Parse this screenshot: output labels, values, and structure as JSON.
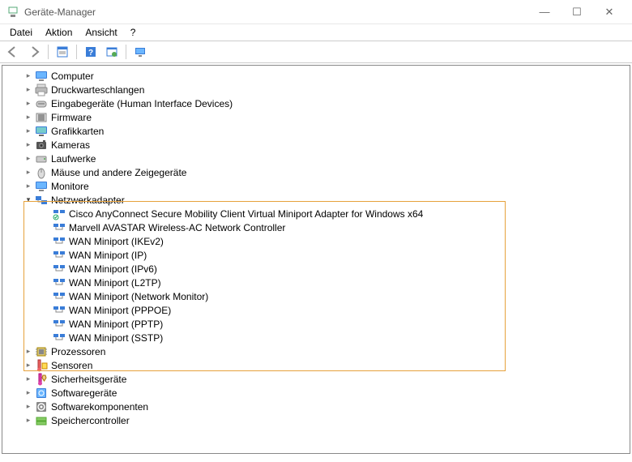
{
  "window": {
    "title": "Geräte-Manager"
  },
  "menu": {
    "file": "Datei",
    "action": "Aktion",
    "view": "Ansicht",
    "help": "?"
  },
  "tree": {
    "items": [
      {
        "label": "Computer",
        "icon": "computer"
      },
      {
        "label": "Druckwarteschlangen",
        "icon": "printer"
      },
      {
        "label": "Eingabegeräte (Human Interface Devices)",
        "icon": "hid"
      },
      {
        "label": "Firmware",
        "icon": "firmware"
      },
      {
        "label": "Grafikkarten",
        "icon": "display"
      },
      {
        "label": "Kameras",
        "icon": "camera"
      },
      {
        "label": "Laufwerke",
        "icon": "drive"
      },
      {
        "label": "Mäuse und andere Zeigegeräte",
        "icon": "mouse"
      },
      {
        "label": "Monitore",
        "icon": "monitor"
      },
      {
        "label": "Netzwerkadapter",
        "icon": "network",
        "expanded": true
      },
      {
        "label": "Prozessoren",
        "icon": "cpu"
      },
      {
        "label": "Sensoren",
        "icon": "sensor"
      },
      {
        "label": "Sicherheitsgeräte",
        "icon": "security"
      },
      {
        "label": "Softwaregeräte",
        "icon": "software"
      },
      {
        "label": "Softwarekomponenten",
        "icon": "swcomp"
      },
      {
        "label": "Speichercontroller",
        "icon": "storage"
      }
    ],
    "network_children": [
      {
        "label": "Cisco AnyConnect Secure Mobility Client Virtual Miniport Adapter for Windows x64",
        "icon": "netspecial"
      },
      {
        "label": "Marvell AVASTAR Wireless-AC Network Controller",
        "icon": "net"
      },
      {
        "label": "WAN Miniport (IKEv2)",
        "icon": "net"
      },
      {
        "label": "WAN Miniport (IP)",
        "icon": "net"
      },
      {
        "label": "WAN Miniport (IPv6)",
        "icon": "net"
      },
      {
        "label": "WAN Miniport (L2TP)",
        "icon": "net"
      },
      {
        "label": "WAN Miniport (Network Monitor)",
        "icon": "net"
      },
      {
        "label": "WAN Miniport (PPPOE)",
        "icon": "net"
      },
      {
        "label": "WAN Miniport (PPTP)",
        "icon": "net"
      },
      {
        "label": "WAN Miniport (SSTP)",
        "icon": "net"
      }
    ]
  }
}
